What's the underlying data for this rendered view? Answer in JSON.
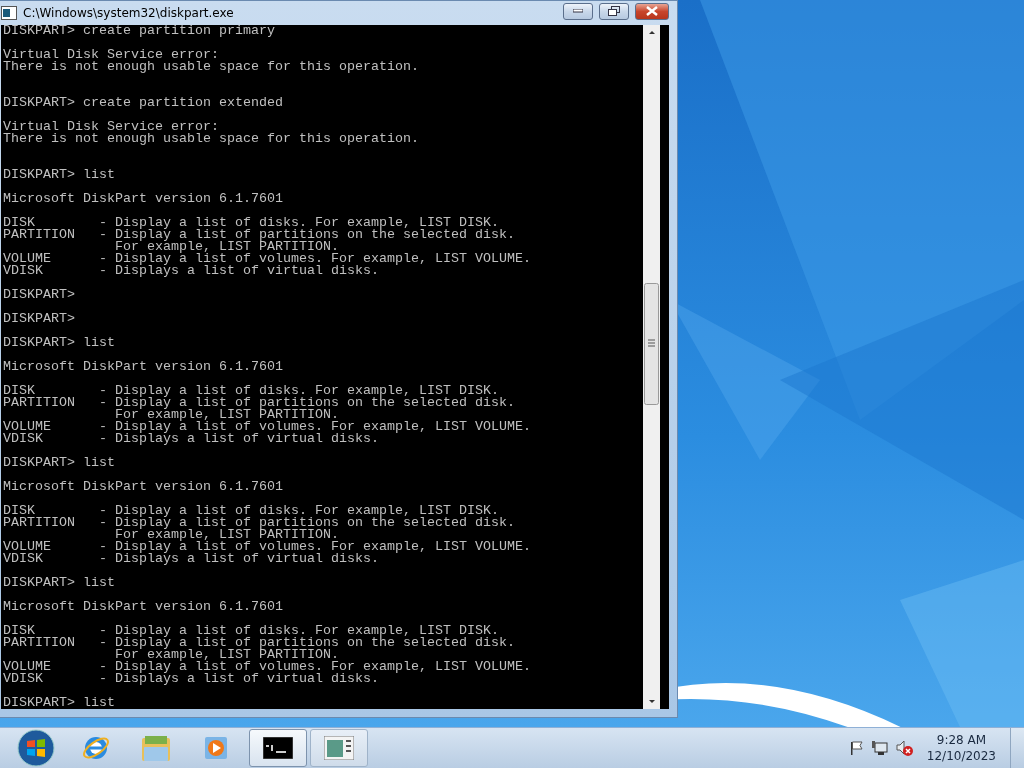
{
  "window": {
    "title": "C:\\Windows\\system32\\diskpart.exe"
  },
  "console": {
    "lines": [
      {
        "kind": "text",
        "text": "DISKPART> create partition primary"
      },
      {
        "kind": "blank"
      },
      {
        "kind": "text",
        "text": "Virtual Disk Service error:"
      },
      {
        "kind": "text",
        "text": "There is not enough usable space for this operation."
      },
      {
        "kind": "blank"
      },
      {
        "kind": "blank"
      },
      {
        "kind": "text",
        "text": "DISKPART> create partition extended"
      },
      {
        "kind": "blank"
      },
      {
        "kind": "text",
        "text": "Virtual Disk Service error:"
      },
      {
        "kind": "text",
        "text": "There is not enough usable space for this operation."
      },
      {
        "kind": "blank"
      },
      {
        "kind": "blank"
      },
      {
        "kind": "text",
        "text": "DISKPART> list"
      },
      {
        "kind": "blank"
      },
      {
        "kind": "text",
        "text": "Microsoft DiskPart version 6.1.7601"
      },
      {
        "kind": "blank"
      },
      {
        "kind": "text",
        "text": "DISK        - Display a list of disks. For example, LIST DISK."
      },
      {
        "kind": "text",
        "text": "PARTITION   - Display a list of partitions on the selected disk."
      },
      {
        "kind": "text",
        "text": "              For example, LIST PARTITION."
      },
      {
        "kind": "text",
        "text": "VOLUME      - Display a list of volumes. For example, LIST VOLUME."
      },
      {
        "kind": "text",
        "text": "VDISK       - Displays a list of virtual disks."
      },
      {
        "kind": "blank"
      },
      {
        "kind": "text",
        "text": "DISKPART>"
      },
      {
        "kind": "blank"
      },
      {
        "kind": "text",
        "text": "DISKPART>"
      },
      {
        "kind": "blank"
      },
      {
        "kind": "text",
        "text": "DISKPART> list"
      },
      {
        "kind": "blank"
      },
      {
        "kind": "text",
        "text": "Microsoft DiskPart version 6.1.7601"
      },
      {
        "kind": "blank"
      },
      {
        "kind": "text",
        "text": "DISK        - Display a list of disks. For example, LIST DISK."
      },
      {
        "kind": "text",
        "text": "PARTITION   - Display a list of partitions on the selected disk."
      },
      {
        "kind": "text",
        "text": "              For example, LIST PARTITION."
      },
      {
        "kind": "text",
        "text": "VOLUME      - Display a list of volumes. For example, LIST VOLUME."
      },
      {
        "kind": "text",
        "text": "VDISK       - Displays a list of virtual disks."
      },
      {
        "kind": "blank"
      },
      {
        "kind": "text",
        "text": "DISKPART> list"
      },
      {
        "kind": "blank"
      },
      {
        "kind": "text",
        "text": "Microsoft DiskPart version 6.1.7601"
      },
      {
        "kind": "blank"
      },
      {
        "kind": "text",
        "text": "DISK        - Display a list of disks. For example, LIST DISK."
      },
      {
        "kind": "text",
        "text": "PARTITION   - Display a list of partitions on the selected disk."
      },
      {
        "kind": "text",
        "text": "              For example, LIST PARTITION."
      },
      {
        "kind": "text",
        "text": "VOLUME      - Display a list of volumes. For example, LIST VOLUME."
      },
      {
        "kind": "text",
        "text": "VDISK       - Displays a list of virtual disks."
      },
      {
        "kind": "blank"
      },
      {
        "kind": "text",
        "text": "DISKPART> list"
      },
      {
        "kind": "blank"
      },
      {
        "kind": "text",
        "text": "Microsoft DiskPart version 6.1.7601"
      },
      {
        "kind": "blank"
      },
      {
        "kind": "text",
        "text": "DISK        - Display a list of disks. For example, LIST DISK."
      },
      {
        "kind": "text",
        "text": "PARTITION   - Display a list of partitions on the selected disk."
      },
      {
        "kind": "text",
        "text": "              For example, LIST PARTITION."
      },
      {
        "kind": "text",
        "text": "VOLUME      - Display a list of volumes. For example, LIST VOLUME."
      },
      {
        "kind": "text",
        "text": "VDISK       - Displays a list of virtual disks."
      },
      {
        "kind": "blank"
      },
      {
        "kind": "text",
        "text": "DISKPART> list"
      }
    ]
  },
  "taskbar": {
    "pinned": [
      {
        "kind": "browser"
      },
      {
        "kind": "folder"
      },
      {
        "kind": "media"
      }
    ],
    "running": [
      {
        "kind": "console",
        "selected": true
      },
      {
        "kind": "document",
        "selected": false
      }
    ],
    "tray": {
      "volume_muted": true,
      "time": "9:28 AM",
      "date": "12/10/2023"
    }
  }
}
